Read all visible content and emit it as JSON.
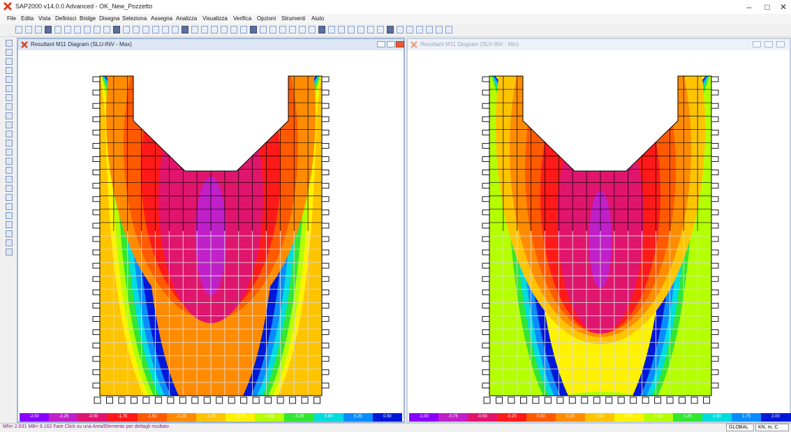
{
  "app": {
    "title": "SAP2000 v14.0.0 Advanced  - OK_New_Pozzetto",
    "window_controls": [
      "–",
      "□",
      "✕"
    ]
  },
  "menu": [
    "File",
    "Edita",
    "Vista",
    "Definisci",
    "Bridge",
    "Disegna",
    "Seleziona",
    "Assegna",
    "Analizza",
    "Visualizza",
    "Verifica",
    "Opzioni",
    "Strumenti",
    "Aiuto"
  ],
  "windows": [
    {
      "title": "Resultant M11 Diagram   (SLU-INV - Max)",
      "active": true
    },
    {
      "title": "Resultant M11 Diagram   (SLV-INV - Min)",
      "active": false
    }
  ],
  "scales": [
    {
      "labels": [
        "-2.50",
        "-2.25",
        "-2.00",
        "-1.75",
        "-1.50",
        "-1.25",
        "-1.00",
        "-0.75",
        "-0.50",
        "-0.25",
        "0.00",
        "0.25",
        "0.50"
      ]
    },
    {
      "labels": [
        "-1.00",
        "-0.75",
        "-0.50",
        "-0.25",
        "0.00",
        "0.25",
        "0.50",
        "0.75",
        "1.00",
        "1.25",
        "1.50",
        "1.75",
        "2.00"
      ]
    }
  ],
  "colors": {
    "contour_palette": [
      "#8a00ff",
      "#c020c8",
      "#e0156e",
      "#ff1a1a",
      "#ff5a00",
      "#ff8c00",
      "#ffc400",
      "#fff200",
      "#b4ff00",
      "#32e632",
      "#00dcdc",
      "#0a8cff",
      "#0018d8"
    ]
  },
  "status": {
    "text": "MN= 2.831  MB= 9.162  Fare Click su una Area/Elemento per dettagli risultato",
    "coord_system": "GLOBAL",
    "units": "KN, m, C"
  }
}
